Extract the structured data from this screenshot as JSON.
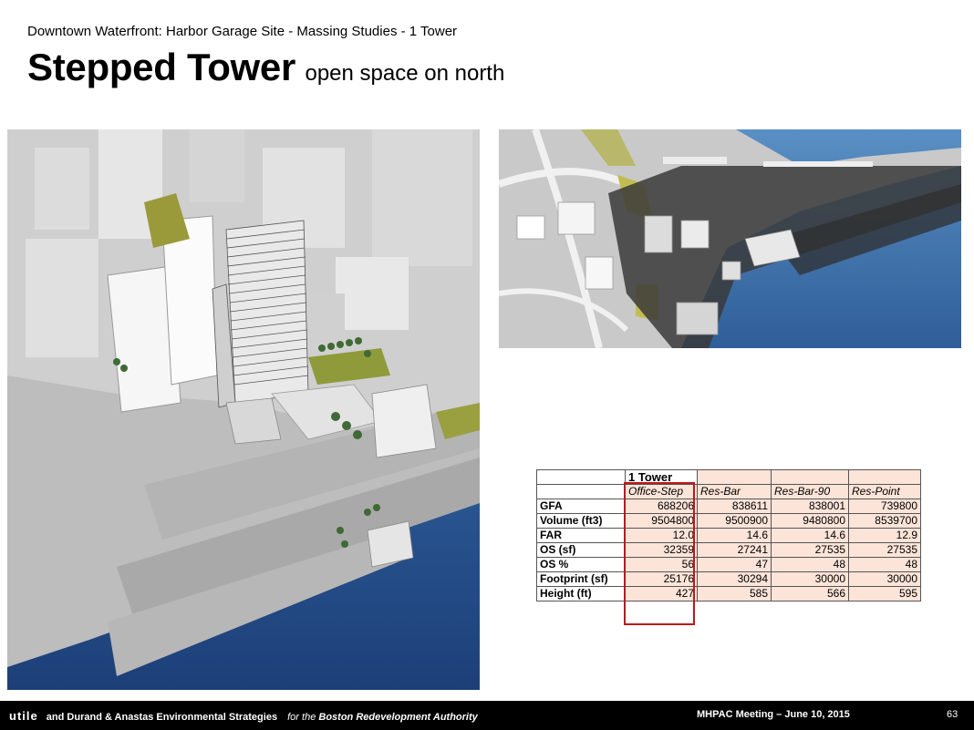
{
  "header": {
    "subtitle": "Downtown Waterfront: Harbor Garage Site - Massing Studies - 1 Tower",
    "title": "Stepped Tower",
    "title_suffix": "open space on north"
  },
  "table": {
    "group_label": "1 Tower",
    "columns": [
      "Office-Step",
      "Res-Bar",
      "Res-Bar-90",
      "Res-Point"
    ],
    "rows": [
      {
        "label": "GFA",
        "values": [
          "688206",
          "838611",
          "838001",
          "739800"
        ]
      },
      {
        "label": "Volume (ft3)",
        "values": [
          "9504800",
          "9500900",
          "9480800",
          "8539700"
        ]
      },
      {
        "label": "FAR",
        "values": [
          "12.0",
          "14.6",
          "14.6",
          "12.9"
        ]
      },
      {
        "label": "OS (sf)",
        "values": [
          "32359",
          "27241",
          "27535",
          "27535"
        ]
      },
      {
        "label": "OS %",
        "values": [
          "56",
          "47",
          "48",
          "48"
        ]
      },
      {
        "label": "Footprint (sf)",
        "values": [
          "25176",
          "30294",
          "30000",
          "30000"
        ]
      },
      {
        "label": "Height (ft)",
        "values": [
          "427",
          "585",
          "566",
          "595"
        ]
      }
    ],
    "highlight_color": "#c0171b",
    "cell_color": "#fde4d8"
  },
  "footer": {
    "logo": "utile",
    "partners": "and Durand & Anastas Environmental Strategies",
    "for_the": "for the",
    "client": "Boston Redevelopment Authority",
    "meeting": "MHPAC Meeting  – June 10, 2015",
    "page": "63"
  }
}
